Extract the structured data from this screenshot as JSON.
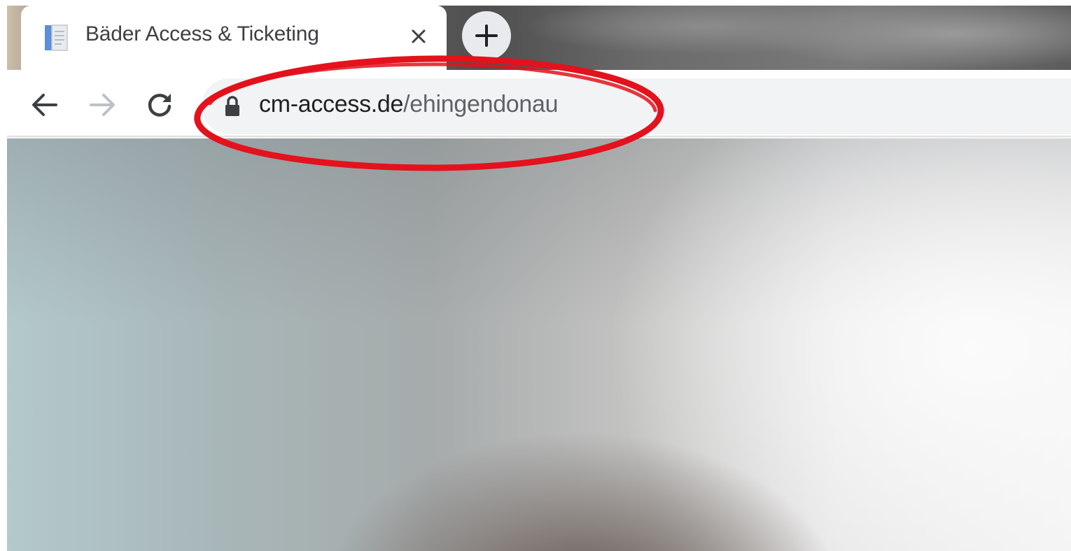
{
  "tab": {
    "title": "Bäder Access & Ticketing",
    "favicon": "document-icon",
    "close_icon": "close-icon"
  },
  "new_tab_icon": "plus-icon",
  "toolbar": {
    "back_icon": "arrow-left-icon",
    "forward_icon": "arrow-right-icon",
    "reload_icon": "reload-icon"
  },
  "omnibox": {
    "security_icon": "lock-icon",
    "url_host": "cm-access.de",
    "url_path": "/ehingendonau"
  },
  "annotation": {
    "shape": "hand-drawn ellipse",
    "color": "#e3121c"
  }
}
